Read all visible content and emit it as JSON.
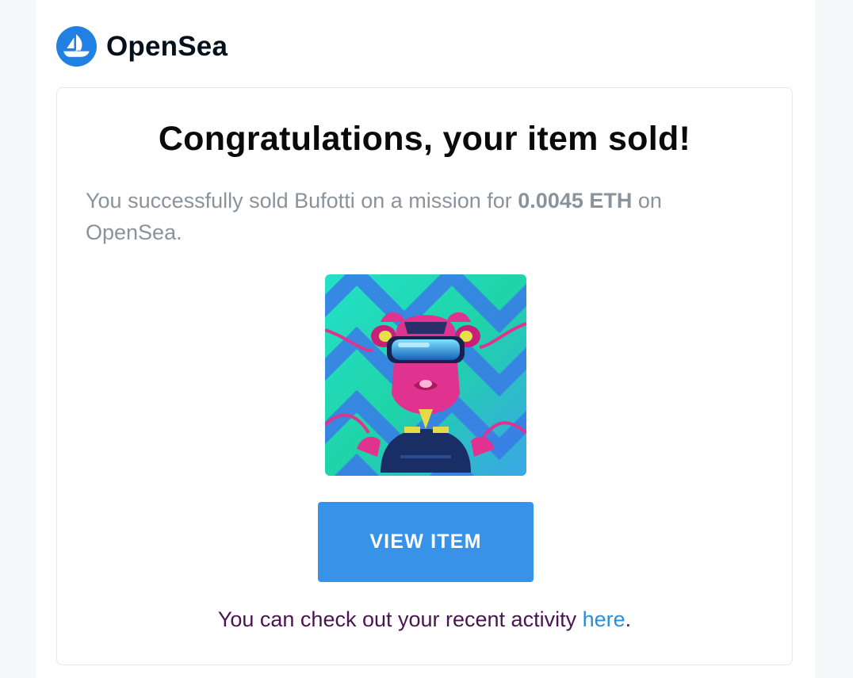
{
  "brand": {
    "name": "OpenSea",
    "logo_icon": "opensea-ship-logo-icon",
    "accent_color": "#2081e2"
  },
  "card": {
    "headline": "Congratulations, your item sold!",
    "message": {
      "prefix": "You successfully sold Bufotti on a mission for ",
      "price": "0.0045 ETH",
      "suffix": " on OpenSea."
    },
    "image_icon": "nft-artwork-image",
    "view_item_button": "VIEW ITEM",
    "button_color": "#3893e8",
    "footer": {
      "text": "You can check out your recent activity ",
      "link_text": "here",
      "end": "."
    }
  }
}
